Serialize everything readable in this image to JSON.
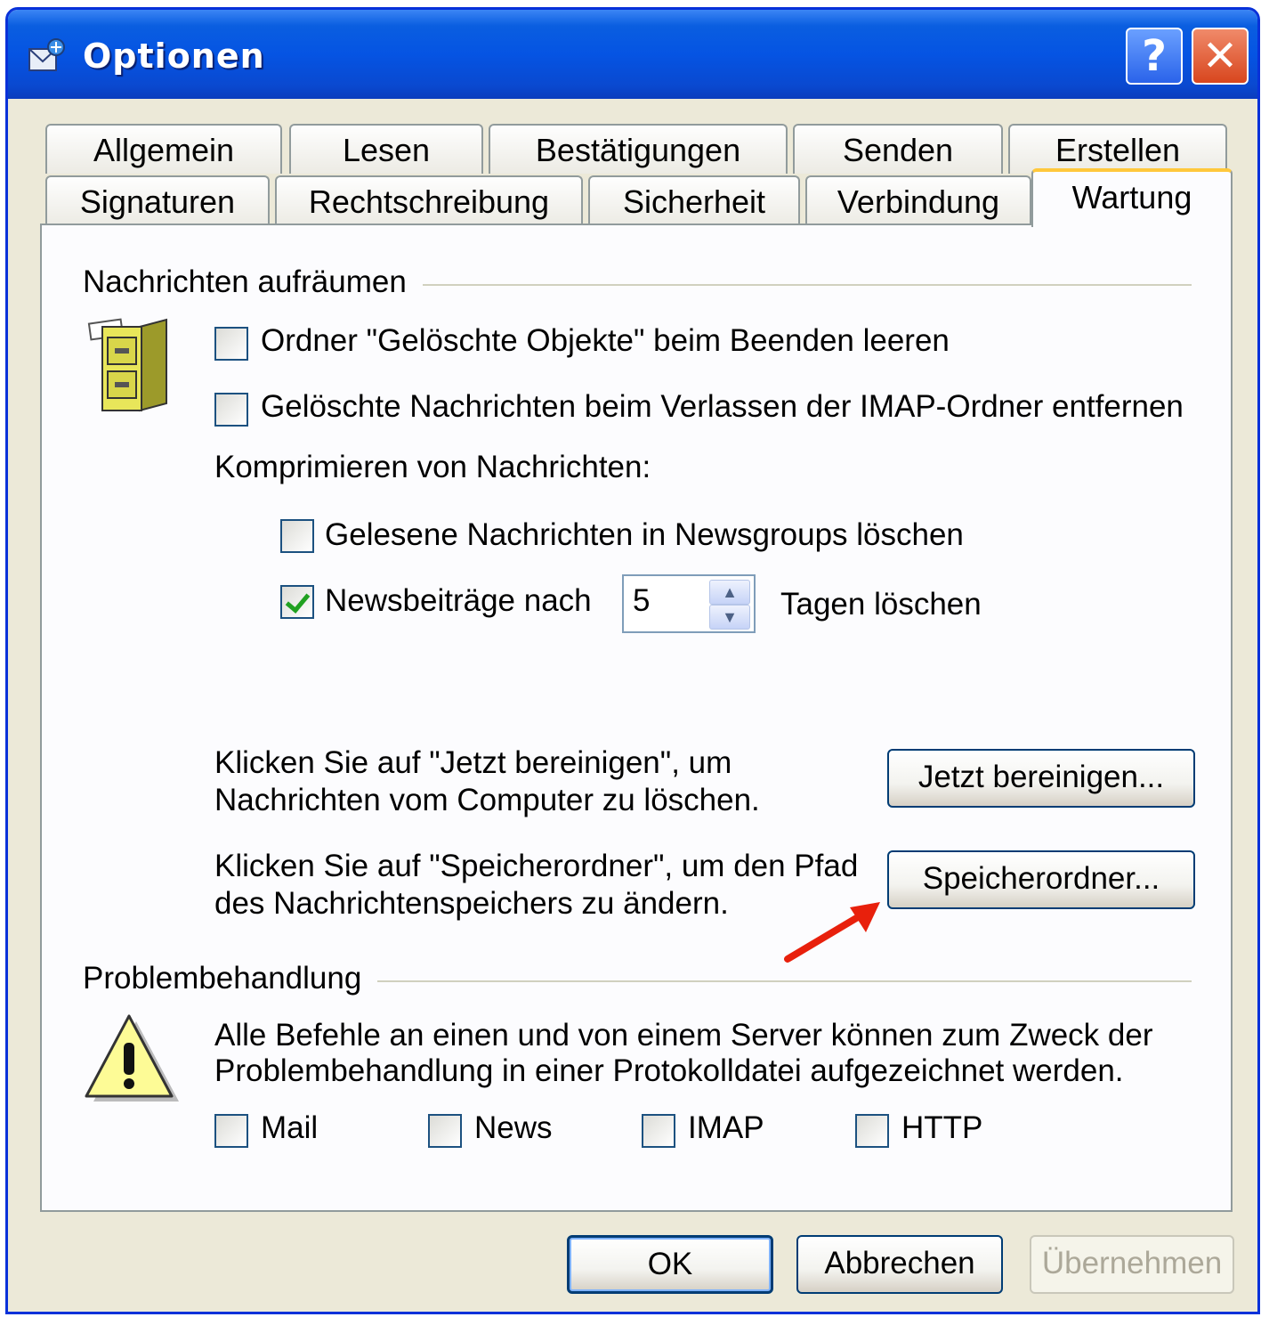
{
  "window": {
    "title": "Optionen",
    "help_icon": "?",
    "close_icon": "✕"
  },
  "tabs_row1": [
    "Allgemein",
    "Lesen",
    "Bestätigungen",
    "Senden",
    "Erstellen"
  ],
  "tabs_row2": [
    "Signaturen",
    "Rechtschreibung",
    "Sicherheit",
    "Verbindung",
    "Wartung"
  ],
  "active_tab": "Wartung",
  "cleanup": {
    "heading": "Nachrichten aufräumen",
    "icon": "file-cabinet-icon",
    "empty_deleted_label": "Ordner \"Gelöschte Objekte\" beim Beenden leeren",
    "empty_deleted_checked": false,
    "purge_imap_label": "Gelöschte Nachrichten beim Verlassen der IMAP-Ordner entfernen",
    "purge_imap_checked": false,
    "compress_label": "Komprimieren von Nachrichten:",
    "delete_read_news_label": "Gelesene Nachrichten in Newsgroups löschen",
    "delete_read_news_checked": false,
    "delete_news_after_label": "Newsbeiträge nach",
    "delete_news_after_checked": true,
    "days_value": "5",
    "days_suffix": "Tagen löschen",
    "clean_now_text_1": "Klicken Sie auf \"Jetzt bereinigen\", um",
    "clean_now_text_2": "Nachrichten vom Computer zu löschen.",
    "clean_now_button": "Jetzt bereinigen...",
    "store_folder_text_1": "Klicken Sie auf \"Speicherordner\", um den Pfad",
    "store_folder_text_2": "des Nachrichtenspeichers zu ändern.",
    "store_folder_button": "Speicherordner..."
  },
  "troubleshooting": {
    "heading": "Problembehandlung",
    "icon": "warning-icon",
    "text_1": "Alle Befehle an einen und von einem Server können zum Zweck der",
    "text_2": "Problembehandlung in einer Protokolldatei aufgezeichnet werden.",
    "options": [
      {
        "label": "Mail",
        "checked": false
      },
      {
        "label": "News",
        "checked": false
      },
      {
        "label": "IMAP",
        "checked": false
      },
      {
        "label": "HTTP",
        "checked": false
      }
    ]
  },
  "footer": {
    "ok": "OK",
    "cancel": "Abbrechen",
    "apply": "Übernehmen"
  },
  "annotation": {
    "arrow_icon": "red-arrow-icon",
    "color": "#e8200c"
  }
}
